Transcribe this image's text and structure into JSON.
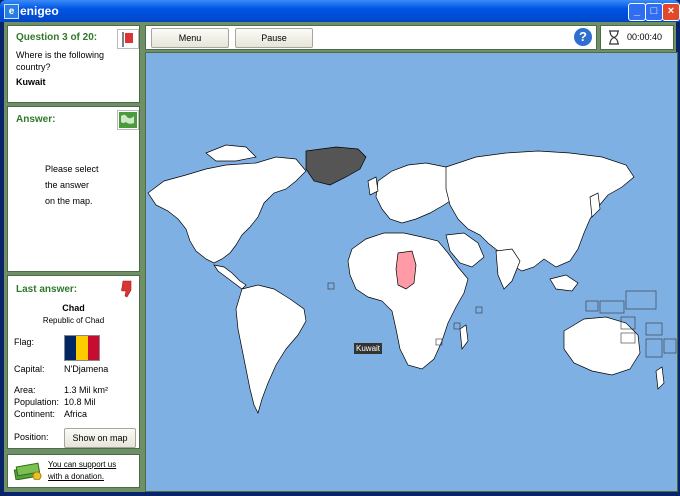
{
  "window": {
    "title": "enigeo"
  },
  "toolbar": {
    "menu_label": "Menu",
    "pause_label": "Pause",
    "timer": "00:00:40"
  },
  "question": {
    "header": "Question 3 of 20:",
    "prompt": "Where is the following country?",
    "country": "Kuwait"
  },
  "answer": {
    "header": "Answer:",
    "line1": "Please select",
    "line2": "the answer",
    "line3": "on the map."
  },
  "last_answer": {
    "header": "Last answer:",
    "name": "Chad",
    "official": "Republic of Chad",
    "flag_label": "Flag:",
    "capital_label": "Capital:",
    "capital": "N'Djamena",
    "area_label": "Area:",
    "area": "1.3 Mil km²",
    "population_label": "Population:",
    "population": "10.8 Mil",
    "continent_label": "Continent:",
    "continent": "Africa",
    "position_label": "Position:",
    "show_button": "Show on map",
    "flag_colors": [
      "#002664",
      "#fecb00",
      "#c60c30"
    ]
  },
  "donation": {
    "line1": "You can support us",
    "line2": "with a donation."
  },
  "map": {
    "tooltip": "Kuwait",
    "ocean_color": "#7fb0e4",
    "highlight_color": "#ff9aa6",
    "land_color": "#ffffff"
  }
}
